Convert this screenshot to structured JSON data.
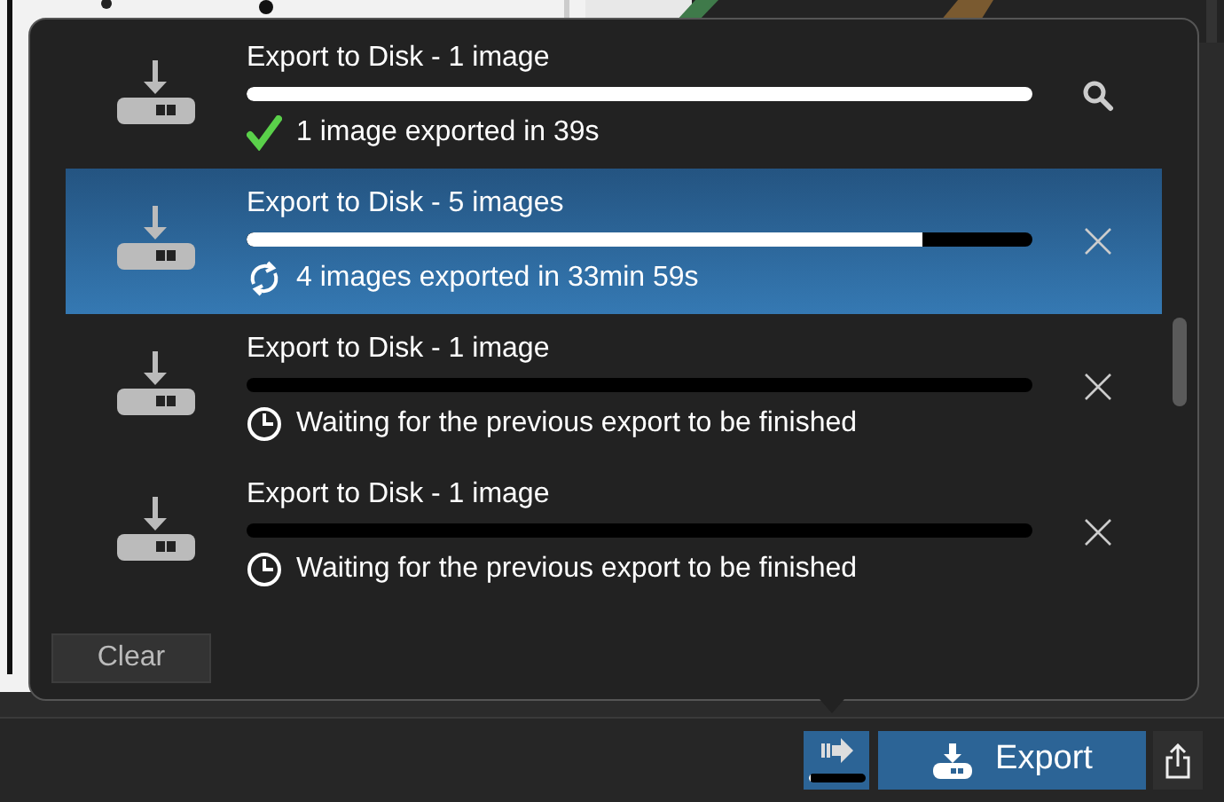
{
  "exports": [
    {
      "title": "Export to Disk - 1 image",
      "level": 1,
      "kind": "done",
      "status": "1 image exported in 39s",
      "selected": false
    },
    {
      "title": "Export to Disk - 5 images",
      "level": 0.86,
      "kind": "running",
      "status": "4 images exported in 33min 59s",
      "selected": true
    },
    {
      "title": "Export to Disk - 1 image",
      "level": 0,
      "kind": "waiting",
      "status": "Waiting for the previous export to be finished",
      "selected": false
    },
    {
      "title": "Export to Disk - 1 image",
      "level": 0,
      "kind": "waiting",
      "status": "Waiting for the previous export to be finished",
      "selected": false
    }
  ],
  "clear_button": "Clear",
  "activity": {
    "level": 0.06
  },
  "export_button": "Export"
}
